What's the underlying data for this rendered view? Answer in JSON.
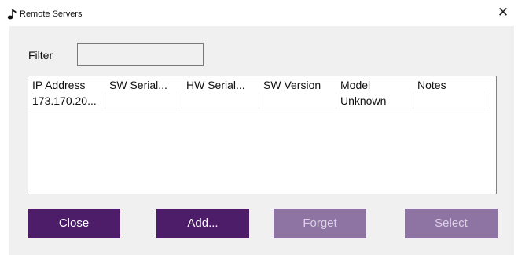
{
  "window": {
    "title": "Remote Servers",
    "icon": "music-note-icon",
    "close_glyph": "✕"
  },
  "filter": {
    "label": "Filter",
    "value": "",
    "placeholder": ""
  },
  "table": {
    "columns": [
      "IP Address",
      "SW Serial...",
      "HW Serial...",
      "SW Version",
      "Model",
      "Notes"
    ],
    "rows": [
      [
        "173.170.20...",
        "",
        "",
        "",
        "Unknown",
        ""
      ]
    ]
  },
  "buttons": {
    "close": {
      "label": "Close",
      "enabled": true
    },
    "add": {
      "label": "Add...",
      "enabled": true
    },
    "forget": {
      "label": "Forget",
      "enabled": false
    },
    "select": {
      "label": "Select",
      "enabled": false
    }
  },
  "colors": {
    "button_enabled": "#4e1d6a",
    "button_disabled": "#8e74a2",
    "dialog_background": "#f0f0f0"
  }
}
